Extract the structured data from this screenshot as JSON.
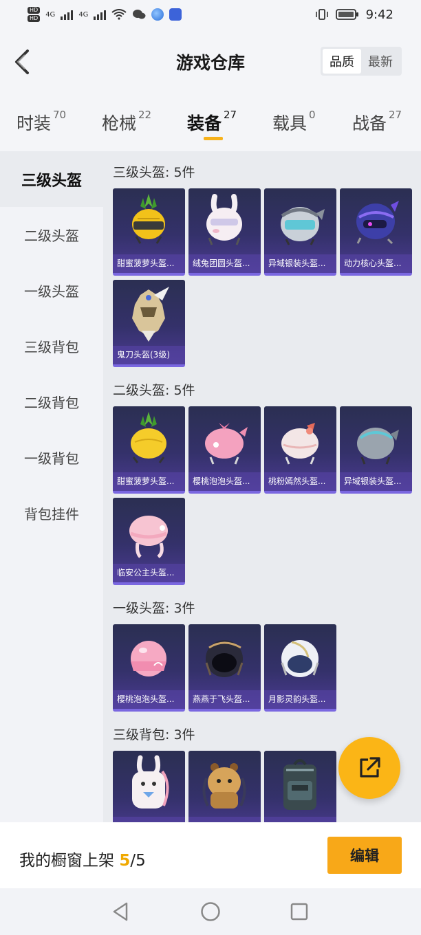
{
  "status": {
    "time": "9:42",
    "signal_tags": [
      "4G",
      "4G"
    ],
    "hd_badges": [
      "HD",
      "HD"
    ]
  },
  "header": {
    "title": "游戏仓库",
    "sort_options": [
      "品质",
      "最新"
    ],
    "active_sort": "品质"
  },
  "tabs": [
    {
      "label": "时装",
      "count": "70"
    },
    {
      "label": "枪械",
      "count": "22"
    },
    {
      "label": "装备",
      "count": "27"
    },
    {
      "label": "载具",
      "count": "0"
    },
    {
      "label": "战备",
      "count": "27"
    }
  ],
  "active_tab": "装备",
  "sidebar": {
    "items": [
      "三级头盔",
      "二级头盔",
      "一级头盔",
      "三级背包",
      "二级背包",
      "一级背包",
      "背包挂件"
    ],
    "active": "三级头盔"
  },
  "sections": [
    {
      "title": "三级头盔: 5件",
      "items": [
        {
          "name": "甜蜜菠萝头盔...",
          "icon": "pineapple-helmet-icon"
        },
        {
          "name": "绒兔团圆头盔...",
          "icon": "bunny-helmet-icon"
        },
        {
          "name": "异域银装头盔...",
          "icon": "exotic-silver-helmet-icon"
        },
        {
          "name": "动力核心头盔...",
          "icon": "power-core-helmet-icon"
        },
        {
          "name": "鬼刀头盔(3级)",
          "icon": "ghost-blade-helmet-icon"
        }
      ]
    },
    {
      "title": "二级头盔: 5件",
      "items": [
        {
          "name": "甜蜜菠萝头盔...",
          "icon": "pineapple-helmet-icon"
        },
        {
          "name": "樱桃泡泡头盔...",
          "icon": "cherry-bubble-helmet-icon"
        },
        {
          "name": "桃粉嫣然头盔...",
          "icon": "peach-pink-helmet-icon"
        },
        {
          "name": "异域银装头盔...",
          "icon": "exotic-silver-helmet-icon"
        },
        {
          "name": "临安公主头盔...",
          "icon": "linan-princess-helmet-icon"
        }
      ]
    },
    {
      "title": "一级头盔: 3件",
      "items": [
        {
          "name": "樱桃泡泡头盔...",
          "icon": "cherry-bubble-helmet-icon"
        },
        {
          "name": "燕燕于飞头盔...",
          "icon": "swallow-helmet-icon"
        },
        {
          "name": "月影灵韵头盔...",
          "icon": "moon-shadow-helmet-icon"
        }
      ]
    },
    {
      "title": "三级背包: 3件",
      "items": [
        {
          "name": "",
          "icon": "bunny-backpack-icon"
        },
        {
          "name": "",
          "icon": "bear-backpack-icon"
        },
        {
          "name": "",
          "icon": "tactical-backpack-icon"
        }
      ]
    }
  ],
  "bottom": {
    "showcase_label": "我的橱窗上架",
    "showcase_current": "5",
    "showcase_sep": "/",
    "showcase_total": "5",
    "edit_label": "编辑"
  },
  "colors": {
    "accent": "#f7b21b",
    "card_bg": "#34316a",
    "card_border": "#7a67e0"
  }
}
